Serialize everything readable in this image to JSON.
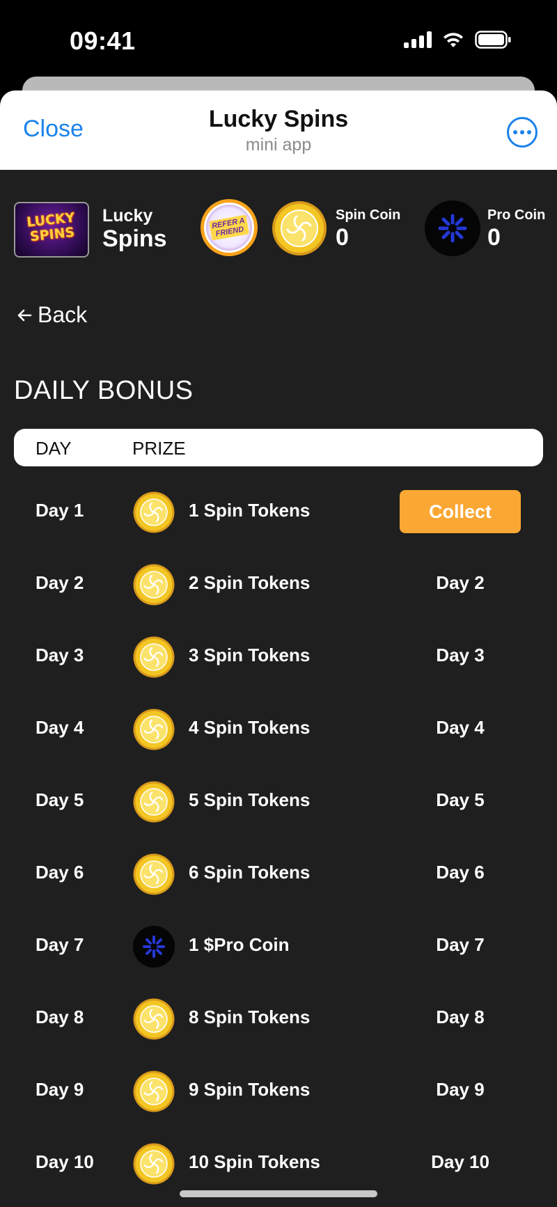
{
  "status_bar": {
    "time": "09:41"
  },
  "header": {
    "close_label": "Close",
    "title": "Lucky Spins",
    "subtitle": "mini app"
  },
  "brand": {
    "logo_text_1": "LUCKY",
    "logo_text_2": "SPINS",
    "name_top": "Lucky",
    "name_bottom": "Spins"
  },
  "refer": {
    "line1": "REFER A",
    "line2": "FRIEND"
  },
  "balances": [
    {
      "label": "Spin Coin",
      "value": "0",
      "icon": "spin-coin-icon"
    },
    {
      "label": "Pro Coin",
      "value": "0",
      "icon": "pro-coin-icon"
    }
  ],
  "nav": {
    "back_label": "Back"
  },
  "page": {
    "heading": "DAILY BONUS"
  },
  "table": {
    "col_day": "DAY",
    "col_prize": "PRIZE",
    "rows": [
      {
        "day": "Day 1",
        "icon": "spin-coin-icon",
        "prize": "1 Spin Tokens",
        "status": "Collect",
        "collectable": true
      },
      {
        "day": "Day 2",
        "icon": "spin-coin-icon",
        "prize": "2 Spin Tokens",
        "status": "Day 2",
        "collectable": false
      },
      {
        "day": "Day 3",
        "icon": "spin-coin-icon",
        "prize": "3 Spin Tokens",
        "status": "Day 3",
        "collectable": false
      },
      {
        "day": "Day 4",
        "icon": "spin-coin-icon",
        "prize": "4 Spin Tokens",
        "status": "Day 4",
        "collectable": false
      },
      {
        "day": "Day 5",
        "icon": "spin-coin-icon",
        "prize": "5 Spin Tokens",
        "status": "Day 5",
        "collectable": false
      },
      {
        "day": "Day 6",
        "icon": "spin-coin-icon",
        "prize": "6 Spin Tokens",
        "status": "Day 6",
        "collectable": false
      },
      {
        "day": "Day 7",
        "icon": "pro-coin-icon",
        "prize": "1 $Pro Coin",
        "status": "Day 7",
        "collectable": false
      },
      {
        "day": "Day 8",
        "icon": "spin-coin-icon",
        "prize": "8 Spin Tokens",
        "status": "Day 8",
        "collectable": false
      },
      {
        "day": "Day 9",
        "icon": "spin-coin-icon",
        "prize": "9 Spin Tokens",
        "status": "Day 9",
        "collectable": false
      },
      {
        "day": "Day 10",
        "icon": "spin-coin-icon",
        "prize": "10 Spin Tokens",
        "status": "Day 10",
        "collectable": false
      }
    ]
  },
  "colors": {
    "accent": "#1a82ea",
    "collect": "#fba733",
    "background": "#1f1f1f",
    "coin_gold": "#f3c623",
    "pro_coin_blue": "#2438d6"
  }
}
